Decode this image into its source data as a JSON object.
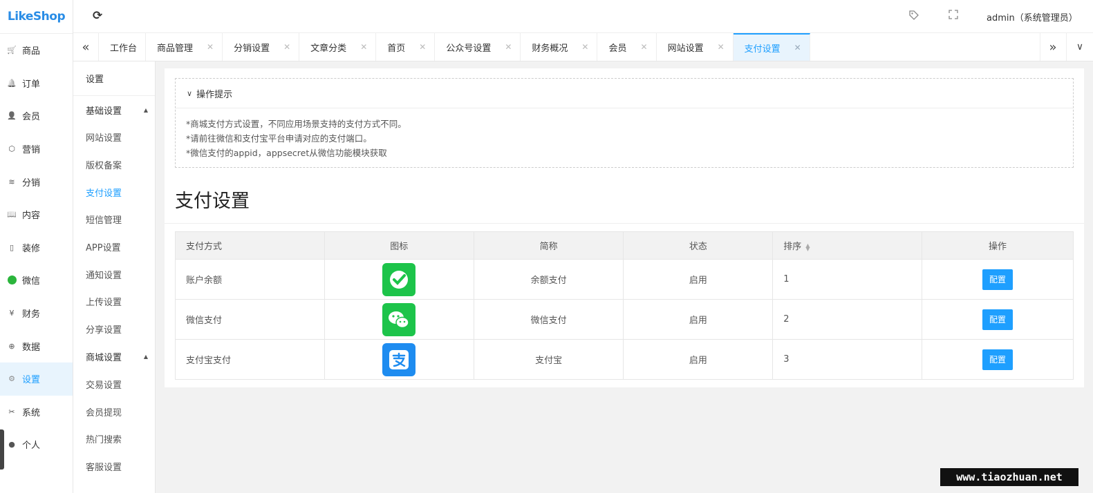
{
  "app": {
    "logo": "LikeShop"
  },
  "header": {
    "user": "admin（系统管理员）"
  },
  "sidebar": {
    "items": [
      {
        "label": "商品",
        "icon": "cart-icon"
      },
      {
        "label": "订单",
        "icon": "bell-icon"
      },
      {
        "label": "会员",
        "icon": "user-icon"
      },
      {
        "label": "营销",
        "icon": "cube-icon"
      },
      {
        "label": "分销",
        "icon": "layers-icon"
      },
      {
        "label": "内容",
        "icon": "book-icon"
      },
      {
        "label": "装修",
        "icon": "phone-icon"
      },
      {
        "label": "微信",
        "icon": "wechat-icon"
      },
      {
        "label": "财务",
        "icon": "yen-icon"
      },
      {
        "label": "数据",
        "icon": "globe-icon"
      },
      {
        "label": "设置",
        "icon": "gear-icon",
        "active": true
      },
      {
        "label": "系统",
        "icon": "tools-icon"
      },
      {
        "label": "个人",
        "icon": "person-icon"
      }
    ]
  },
  "tabs": [
    {
      "label": "工作台",
      "closable": false
    },
    {
      "label": "商品管理",
      "closable": true
    },
    {
      "label": "分销设置",
      "closable": true
    },
    {
      "label": "文章分类",
      "closable": true
    },
    {
      "label": "首页",
      "closable": true
    },
    {
      "label": "公众号设置",
      "closable": true
    },
    {
      "label": "财务概况",
      "closable": true
    },
    {
      "label": "会员",
      "closable": true
    },
    {
      "label": "网站设置",
      "closable": true
    },
    {
      "label": "支付设置",
      "closable": true,
      "active": true
    }
  ],
  "subnav": {
    "title": "设置",
    "group1": "基础设置",
    "items1": [
      "网站设置",
      "版权备案",
      "支付设置",
      "短信管理",
      "APP设置",
      "通知设置",
      "上传设置",
      "分享设置"
    ],
    "group2": "商城设置",
    "items2": [
      "交易设置",
      "会员提现",
      "热门搜索",
      "客服设置"
    ]
  },
  "tips": {
    "title": "操作提示",
    "lines": [
      "*商城支付方式设置，不同应用场景支持的支付方式不同。",
      "*请前往微信和支付宝平台申请对应的支付端口。",
      "*微信支付的appid，appsecret从微信功能模块获取"
    ]
  },
  "page_title": "支付设置",
  "table": {
    "headers": {
      "method": "支付方式",
      "icon": "图标",
      "short": "简称",
      "status": "状态",
      "sort": "排序",
      "action": "操作"
    },
    "rows": [
      {
        "method": "账户余额",
        "icon": "balance-pay-icon",
        "short": "余额支付",
        "status": "启用",
        "sort": "1",
        "action": "配置",
        "color": "#1dc44a"
      },
      {
        "method": "微信支付",
        "icon": "wechat-pay-icon",
        "short": "微信支付",
        "status": "启用",
        "sort": "2",
        "action": "配置",
        "color": "#1dc44a"
      },
      {
        "method": "支付宝支付",
        "icon": "alipay-icon",
        "short": "支付宝",
        "status": "启用",
        "sort": "3",
        "action": "配置",
        "color": "#1e8cf0"
      }
    ]
  },
  "watermark": "www.tiaozhuan.net",
  "colors": {
    "accent": "#1e9fff",
    "active_bg": "#e8f4fd"
  }
}
